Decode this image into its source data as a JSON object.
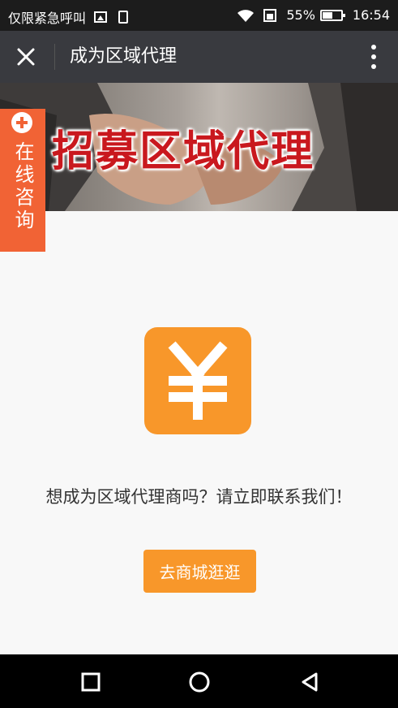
{
  "status_bar": {
    "carrier": "仅限紧急呼叫",
    "battery": "55%",
    "time": "16:54",
    "icons": [
      "image-icon",
      "sim-icon",
      "wifi-icon",
      "phone-icon",
      "battery-icon"
    ]
  },
  "title_bar": {
    "title": "成为区域代理",
    "close_icon": "close-icon",
    "more_icon": "more-vertical-icon"
  },
  "banner": {
    "text": "招募区域代理"
  },
  "consult_tab": {
    "label": "在线咨询",
    "color": "#f16335"
  },
  "content": {
    "icon": "yen-icon",
    "message": "想成为区域代理商吗？请立即联系我们！",
    "button_label": "去商城逛逛",
    "accent_color": "#f8972a"
  },
  "nav_bar": {
    "buttons": [
      "recent-apps-icon",
      "home-icon",
      "back-icon"
    ]
  }
}
